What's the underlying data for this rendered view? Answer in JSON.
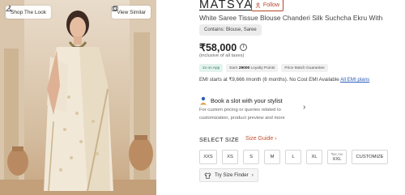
{
  "image": {
    "shop_look_label": "Shop The Look",
    "view_similar_label": "View Similar"
  },
  "product": {
    "brand": "MATSYA",
    "follow_label": "Follow",
    "title": "White Saree Tissue Blouse Chanderi Silk Suchcha Ekru With",
    "contains": "Contains: Blouse, Saree",
    "price": "₹58,000",
    "tax_note": "(inclusive of all taxes)",
    "chips": {
      "app": "2x on App",
      "loyalty_prefix": "Earn ",
      "loyalty_points": "29000",
      "loyalty_suffix": " Loyalty Points",
      "price_match": "Price Match Guarantee"
    },
    "emi": {
      "text": "EMI starts at ₹9,666 /month (6 months). No Cost EMI Available ",
      "link": "All EMI plans"
    }
  },
  "stylist": {
    "title": "Book a slot with your stylist",
    "description": "For custom pricing or queries related to customization, product preview and more"
  },
  "sizes": {
    "label": "SELECT SIZE",
    "guide_label": "Size Guide",
    "guide_chevron": "›",
    "items": [
      {
        "label": "XXS",
        "price": ""
      },
      {
        "label": "XS",
        "price": ""
      },
      {
        "label": "S",
        "price": ""
      },
      {
        "label": "M",
        "price": ""
      },
      {
        "label": "L",
        "price": ""
      },
      {
        "label": "XL",
        "price": ""
      },
      {
        "label": "XXL",
        "price": "₹66,700"
      },
      {
        "label": "CUSTOMIZE",
        "price": ""
      }
    ],
    "try_finder_label": "Try Size Finder",
    "try_finder_chevron": "›"
  },
  "colors": {
    "accent": "#b5452e",
    "link": "#2c5fb8",
    "app_chip_bg": "#e4f3ee"
  }
}
